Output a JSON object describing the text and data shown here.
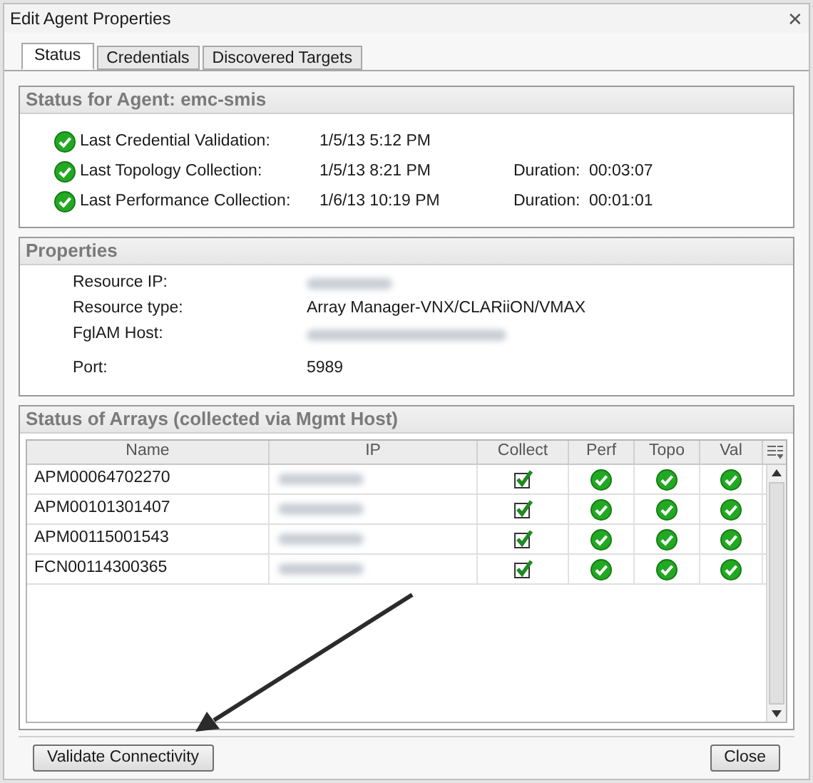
{
  "window": {
    "title": "Edit Agent Properties",
    "close": "✕"
  },
  "tabs": [
    {
      "label": "Status",
      "selected": true
    },
    {
      "label": "Credentials",
      "selected": false
    },
    {
      "label": "Discovered Targets",
      "selected": false
    }
  ],
  "agent_status": {
    "title": "Status for Agent: emc-smis",
    "items": [
      {
        "label": "Last Credential Validation:",
        "ok": true,
        "time": "1/5/13 5:12 PM"
      },
      {
        "label": "Last Topology Collection:",
        "ok": true,
        "time": "1/5/13 8:21 PM",
        "duration_label": "Duration:",
        "duration": "00:03:07"
      },
      {
        "label": "Last Performance Collection:",
        "ok": true,
        "time": "1/6/13 10:19 PM",
        "duration_label": "Duration:",
        "duration": "00:01:01"
      }
    ]
  },
  "properties": {
    "title": "Properties",
    "items": [
      {
        "label": "Resource IP:",
        "kind": "redacted"
      },
      {
        "label": "Resource type:",
        "kind": "text",
        "value": "Array Manager-VNX/CLARiiON/VMAX"
      },
      {
        "label": "FglAM Host:",
        "kind": "redacted"
      },
      {
        "label": "Port:",
        "kind": "text",
        "value": "5989"
      }
    ]
  },
  "arrays": {
    "title": "Status of Arrays (collected via Mgmt Host)",
    "columns": [
      "Name",
      "IP",
      "Collect",
      "Perf",
      "Topo",
      "Val"
    ],
    "rows": [
      {
        "name": "APM00064702270",
        "collect": true,
        "perf_ok": true,
        "topo_ok": true,
        "val_ok": true
      },
      {
        "name": "APM00101301407",
        "collect": true,
        "perf_ok": true,
        "topo_ok": true,
        "val_ok": true
      },
      {
        "name": "APM00115001543",
        "collect": true,
        "perf_ok": true,
        "topo_ok": true,
        "val_ok": true
      },
      {
        "name": "FCN00114300365",
        "collect": true,
        "perf_ok": true,
        "topo_ok": true,
        "val_ok": true
      }
    ]
  },
  "buttons": {
    "validate": "Validate Connectivity",
    "close": "Close"
  }
}
